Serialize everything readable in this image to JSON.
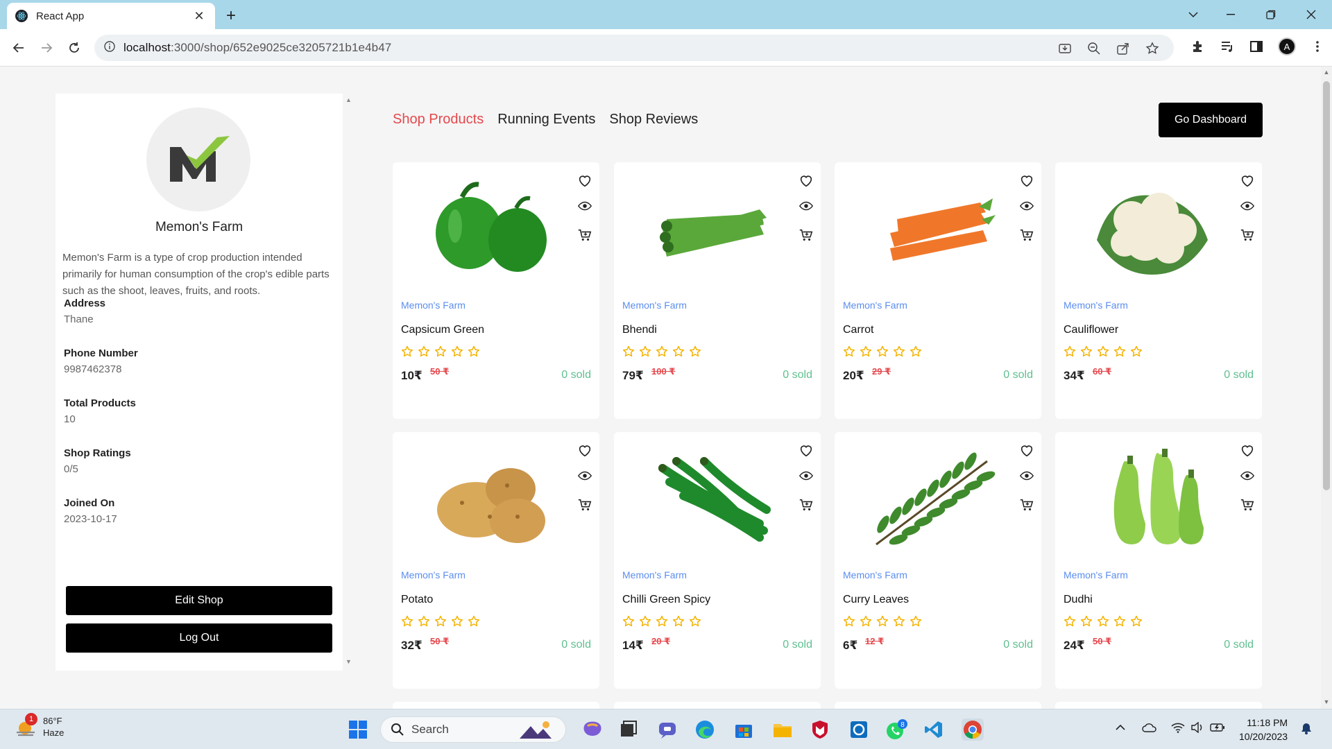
{
  "browser": {
    "tab_title": "React App",
    "tab_close": "✕",
    "new_tab": "+",
    "url_host": "localhost",
    "url_path": ":3000/shop/652e9025ce3205721b1e4b47"
  },
  "sidebar": {
    "shop_name": "Memon's Farm",
    "description": "Memon's Farm is a type of crop production intended primarily for human consumption of the crop's edible parts such as the shoot, leaves, fruits, and roots.",
    "info": [
      {
        "label": "Address",
        "value": "Thane"
      },
      {
        "label": "Phone Number",
        "value": "9987462378"
      },
      {
        "label": "Total Products",
        "value": "10"
      },
      {
        "label": "Shop Ratings",
        "value": "0/5"
      },
      {
        "label": "Joined On",
        "value": "2023-10-17"
      }
    ],
    "edit_button": "Edit Shop",
    "logout_button": "Log Out"
  },
  "tabs": {
    "products": "Shop Products",
    "events": "Running Events",
    "reviews": "Shop Reviews"
  },
  "dashboard_button": "Go Dashboard",
  "products": [
    {
      "shop": "Memon's Farm",
      "name": "Capsicum Green",
      "price": "10₹",
      "original_price": "50 ₹",
      "sold": "0 sold",
      "image": "capsicum",
      "color": "#2e9a2a"
    },
    {
      "shop": "Memon's Farm",
      "name": "Bhendi",
      "price": "79₹",
      "original_price": "100 ₹",
      "sold": "0 sold",
      "image": "okra",
      "color": "#5aa83a"
    },
    {
      "shop": "Memon's Farm",
      "name": "Carrot",
      "price": "20₹",
      "original_price": "29 ₹",
      "sold": "0 sold",
      "image": "carrot",
      "color": "#f0772a"
    },
    {
      "shop": "Memon's Farm",
      "name": "Cauliflower",
      "price": "34₹",
      "original_price": "60 ₹",
      "sold": "0 sold",
      "image": "cauliflower",
      "color": "#f2ecd8"
    },
    {
      "shop": "Memon's Farm",
      "name": "Potato",
      "price": "32₹",
      "original_price": "50 ₹",
      "sold": "0 sold",
      "image": "potato",
      "color": "#d9a95a"
    },
    {
      "shop": "Memon's Farm",
      "name": "Chilli Green Spicy",
      "price": "14₹",
      "original_price": "20 ₹",
      "sold": "0 sold",
      "image": "chilli",
      "color": "#1f8a2c"
    },
    {
      "shop": "Memon's Farm",
      "name": "Curry Leaves",
      "price": "6₹",
      "original_price": "12 ₹",
      "sold": "0 sold",
      "image": "curry-leaves",
      "color": "#3f8a2c"
    },
    {
      "shop": "Memon's Farm",
      "name": "Dudhi",
      "price": "24₹",
      "original_price": "50 ₹",
      "sold": "0 sold",
      "image": "bottle-gourd",
      "color": "#8fcc4a"
    }
  ],
  "taskbar": {
    "weather_temp": "86°F",
    "weather_desc": "Haze",
    "weather_badge": "1",
    "search_label": "Search",
    "whatsapp_badge": "8",
    "time": "11:18 PM",
    "date": "10/20/2023"
  },
  "colors": {
    "accent_red": "#e5484d",
    "shop_link_blue": "#5b8def",
    "sold_green": "#5fbf8f",
    "star_yellow": "#f5b301"
  }
}
